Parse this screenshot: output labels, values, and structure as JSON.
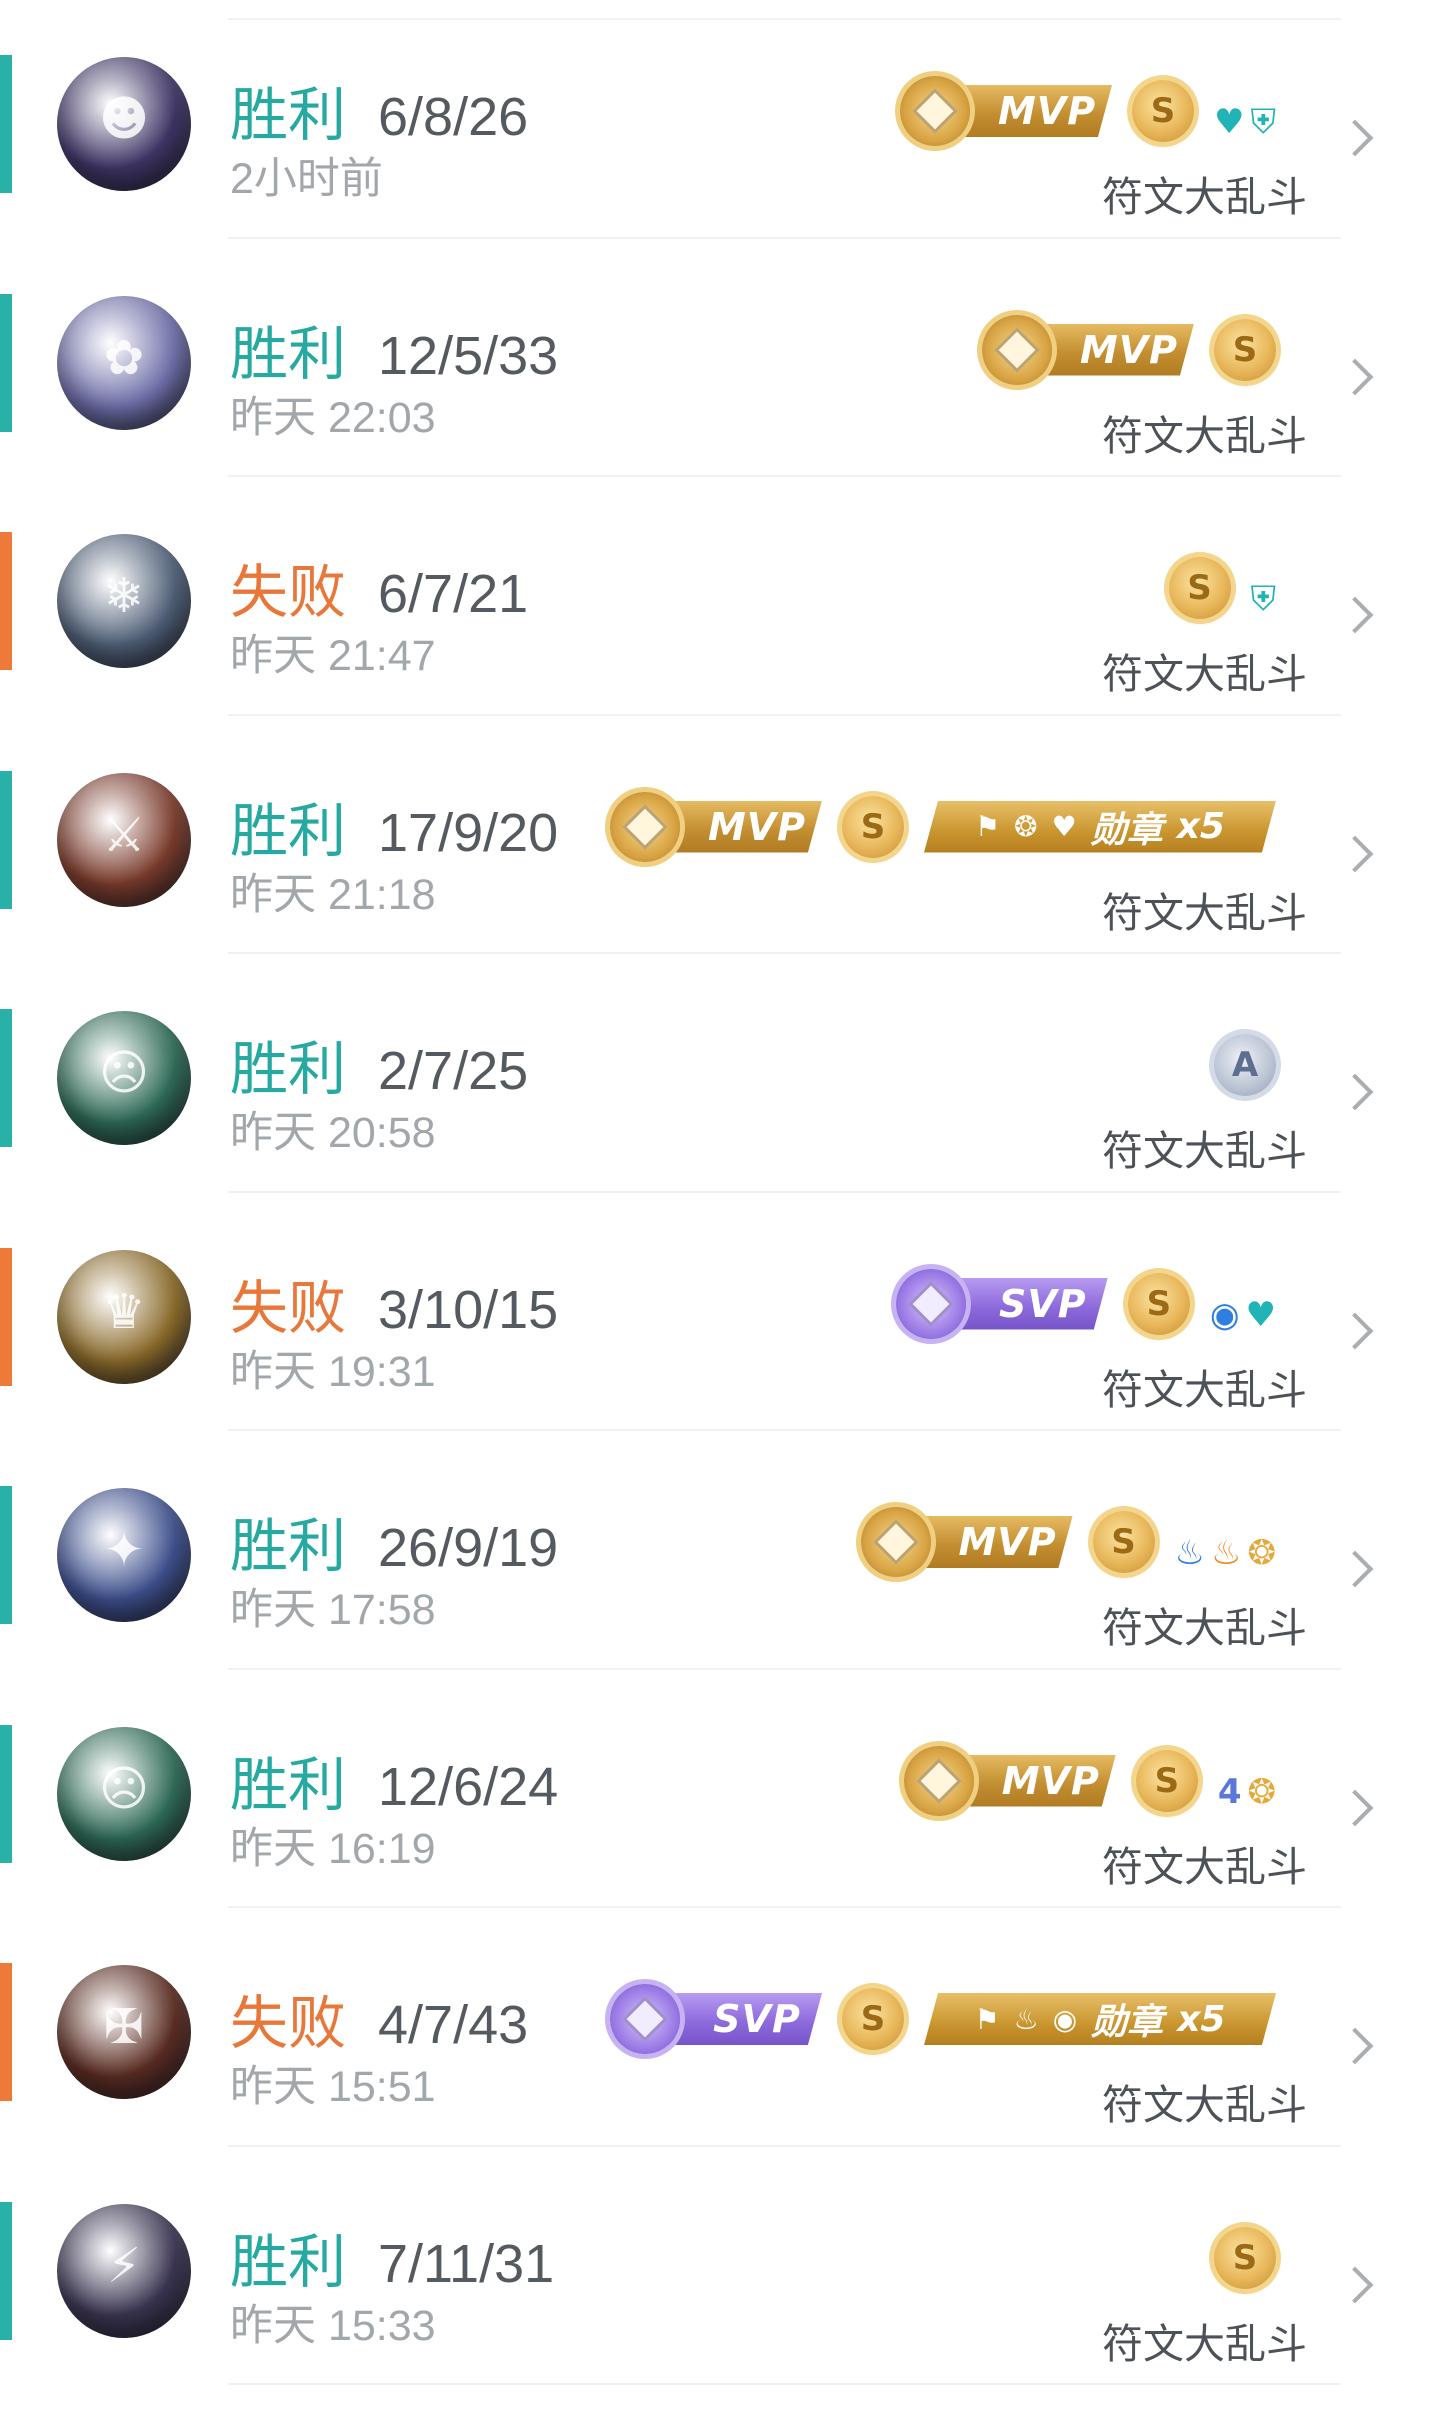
{
  "colors": {
    "win": "#26a9a1",
    "loss": "#e8773a",
    "win_bar": "#2ab1a7",
    "loss_bar": "#ee7a3a"
  },
  "labels": {
    "mvp": "MVP",
    "svp": "SVP",
    "coin": "S",
    "rank_a": "A",
    "medal_prefix": "勋章",
    "medal_count": "x5"
  },
  "matches": [
    {
      "result": "胜利",
      "outcome": "win",
      "kda": "6/8/26",
      "time": "2小时前",
      "mode": "符文大乱斗",
      "avatar": {
        "icon": "dark-goblin-champion-portrait",
        "glyph": "☻",
        "bg": "#3f3566"
      },
      "mvp": "mvp",
      "coin": true,
      "rank": false,
      "medal": false,
      "extra_icons": [
        "heart-plus-icon",
        "shield-icon"
      ],
      "extra_glyphs": [
        "♥",
        "⛨"
      ],
      "extra_colors": [
        "si-teal",
        "si-teal"
      ]
    },
    {
      "result": "胜利",
      "outcome": "win",
      "kda": "12/5/33",
      "time": "昨天 22:03",
      "mode": "符文大乱斗",
      "avatar": {
        "icon": "yordle-champion-portrait",
        "glyph": "✿",
        "bg": "#6d6ea8"
      },
      "mvp": "mvp",
      "coin": true,
      "rank": false,
      "medal": false,
      "extra_icons": [],
      "extra_glyphs": [],
      "extra_colors": []
    },
    {
      "result": "失败",
      "outcome": "loss",
      "kda": "6/7/21",
      "time": "昨天 21:47",
      "mode": "符文大乱斗",
      "avatar": {
        "icon": "wolf-champion-portrait",
        "glyph": "❄",
        "bg": "#4f5f77"
      },
      "mvp": "",
      "coin": true,
      "rank": false,
      "medal": false,
      "extra_icons": [
        "shield-icon"
      ],
      "extra_glyphs": [
        "⛨"
      ],
      "extra_colors": [
        "si-teal"
      ]
    },
    {
      "result": "胜利",
      "outcome": "win",
      "kda": "17/9/20",
      "time": "昨天 21:18",
      "mode": "符文大乱斗",
      "avatar": {
        "icon": "warrior-champion-portrait",
        "glyph": "⚔",
        "bg": "#7a3b2c"
      },
      "mvp": "mvp",
      "coin": true,
      "rank": false,
      "medal": true,
      "medal_icons": [
        "flag-icon",
        "coins-icon",
        "heart-plus-icon"
      ],
      "medal_glyphs": [
        "⚑",
        "❂",
        "♥"
      ],
      "extra_icons": [],
      "extra_glyphs": [],
      "extra_colors": []
    },
    {
      "result": "胜利",
      "outcome": "win",
      "kda": "2/7/25",
      "time": "昨天 20:58",
      "mode": "符文大乱斗",
      "avatar": {
        "icon": "mummy-champion-portrait",
        "glyph": "☹",
        "bg": "#2e6a57"
      },
      "mvp": "",
      "coin": false,
      "rank": true,
      "medal": false,
      "extra_icons": [],
      "extra_glyphs": [],
      "extra_colors": []
    },
    {
      "result": "失败",
      "outcome": "loss",
      "kda": "3/10/15",
      "time": "昨天 19:31",
      "mode": "符文大乱斗",
      "avatar": {
        "icon": "golden-mummy-champion-portrait",
        "glyph": "♛",
        "bg": "#8a6a2a"
      },
      "mvp": "svp",
      "coin": true,
      "rank": false,
      "medal": false,
      "extra_icons": [
        "eye-icon",
        "heart-plus-icon"
      ],
      "extra_glyphs": [
        "◉",
        "♥"
      ],
      "extra_colors": [
        "si-blue",
        "si-teal"
      ]
    },
    {
      "result": "胜利",
      "outcome": "win",
      "kda": "26/9/19",
      "time": "昨天 17:58",
      "mode": "符文大乱斗",
      "avatar": {
        "icon": "jinx-champion-portrait",
        "glyph": "✦",
        "bg": "#3d4f8c"
      },
      "mvp": "mvp",
      "coin": true,
      "rank": false,
      "medal": false,
      "extra_icons": [
        "flame-blue-icon",
        "flame-orange-icon",
        "coins-icon"
      ],
      "extra_glyphs": [
        "♨",
        "♨",
        "❂"
      ],
      "extra_colors": [
        "si-blue",
        "si-orange",
        "si-gold"
      ]
    },
    {
      "result": "胜利",
      "outcome": "win",
      "kda": "12/6/24",
      "time": "昨天 16:19",
      "mode": "符文大乱斗",
      "avatar": {
        "icon": "mummy-champion-portrait",
        "glyph": "☹",
        "bg": "#2e6a57"
      },
      "mvp": "mvp",
      "coin": true,
      "rank": false,
      "medal": false,
      "extra_icons": [
        "quadra-kill-icon",
        "coins-icon"
      ],
      "extra_glyphs": [
        "4",
        "❂"
      ],
      "extra_colors": [
        "si-indigo",
        "si-gold"
      ]
    },
    {
      "result": "失败",
      "outcome": "loss",
      "kda": "4/7/43",
      "time": "昨天 15:51",
      "mode": "符文大乱斗",
      "avatar": {
        "icon": "swain-champion-portrait",
        "glyph": "✠",
        "bg": "#5a2c22"
      },
      "mvp": "svp",
      "coin": true,
      "rank": false,
      "medal": true,
      "medal_icons": [
        "flag-icon",
        "flame-icon",
        "eye-icon"
      ],
      "medal_glyphs": [
        "⚑",
        "♨",
        "◉"
      ],
      "extra_icons": [],
      "extra_glyphs": [],
      "extra_colors": []
    },
    {
      "result": "胜利",
      "outcome": "win",
      "kda": "7/11/31",
      "time": "昨天 15:33",
      "mode": "符文大乱斗",
      "avatar": {
        "icon": "yasuo-champion-portrait",
        "glyph": "⚡",
        "bg": "#3b3552"
      },
      "mvp": "",
      "coin": true,
      "rank": false,
      "medal": false,
      "extra_icons": [],
      "extra_glyphs": [],
      "extra_colors": []
    }
  ]
}
